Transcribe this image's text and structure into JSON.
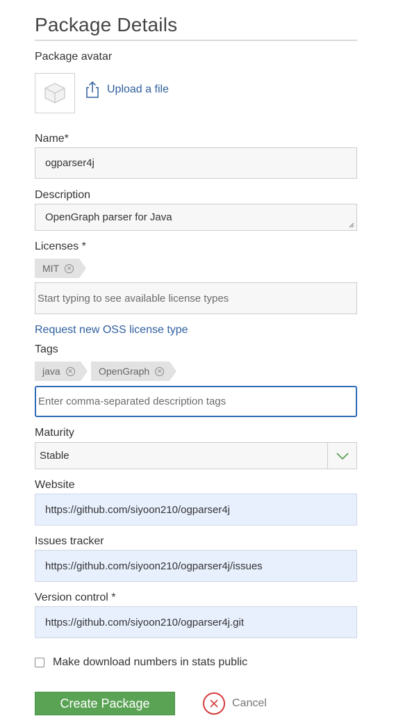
{
  "header": {
    "title": "Package Details"
  },
  "avatar": {
    "label": "Package avatar",
    "upload_label": "Upload a file"
  },
  "name": {
    "label": "Name*",
    "value": "ogparser4j"
  },
  "description": {
    "label": "Description",
    "value": "OpenGraph parser for Java"
  },
  "licenses": {
    "label": "Licenses *",
    "chips": [
      {
        "label": "MIT"
      }
    ],
    "placeholder": "Start typing to see available license types",
    "request_link": "Request new OSS license type"
  },
  "tags": {
    "label": "Tags",
    "chips": [
      {
        "label": "java"
      },
      {
        "label": "OpenGraph"
      }
    ],
    "placeholder": "Enter comma-separated description tags"
  },
  "maturity": {
    "label": "Maturity",
    "selected": "Stable"
  },
  "website": {
    "label": "Website",
    "value": "https://github.com/siyoon210/ogparser4j"
  },
  "issues": {
    "label": "Issues tracker",
    "value": "https://github.com/siyoon210/ogparser4j/issues"
  },
  "vcs": {
    "label": "Version control *",
    "value": "https://github.com/siyoon210/ogparser4j.git"
  },
  "stats": {
    "label": "Make download numbers in stats public",
    "checked": false
  },
  "actions": {
    "create_label": "Create Package",
    "cancel_label": "Cancel"
  },
  "colors": {
    "link": "#2f5f9e",
    "primary_button": "#5aa355",
    "focus_border": "#2d6bb5",
    "cancel_icon": "#d43b3b",
    "autofill_bg": "#e8f0fe"
  }
}
